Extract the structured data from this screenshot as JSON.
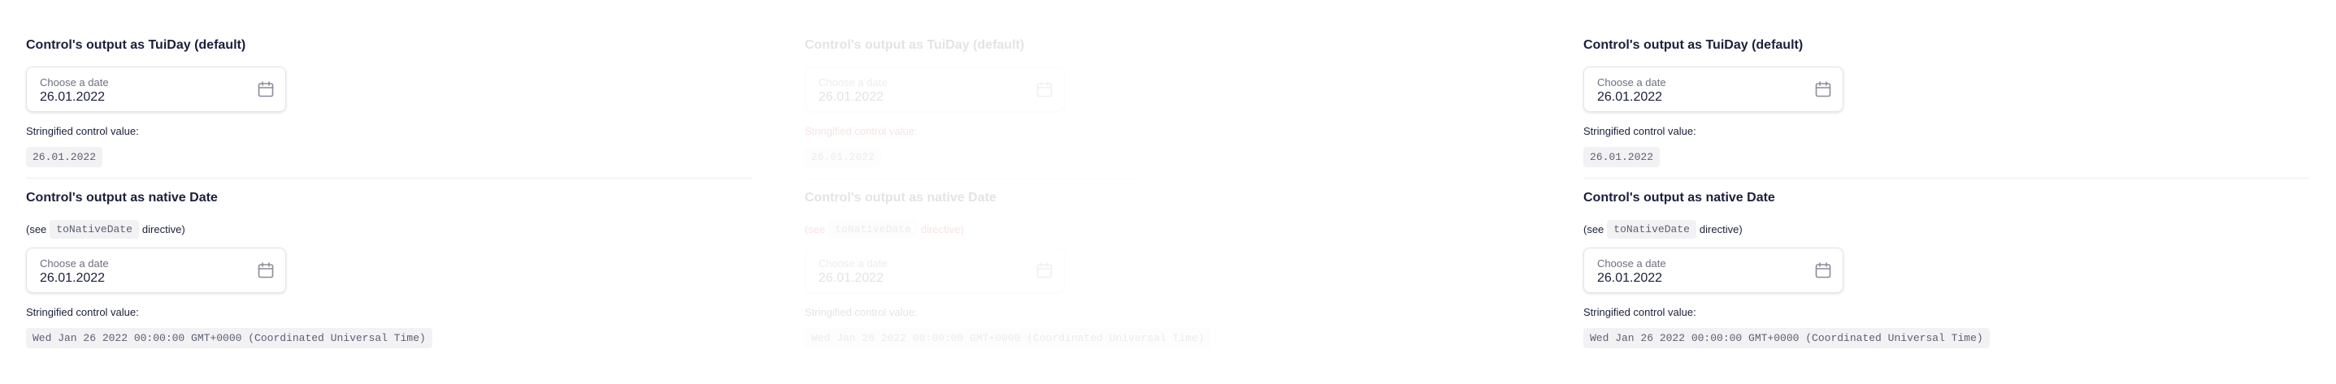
{
  "columns": [
    {
      "section1": {
        "title": "Control's output as TuiDay (default)",
        "date_label": "Choose a date",
        "date_value": "26.01.2022",
        "caption": "Stringified control value:",
        "value": "26.01.2022"
      },
      "section2": {
        "title": "Control's output as native Date",
        "note_prefix": "(see",
        "note_code": "toNativeDate",
        "note_suffix": "directive)",
        "date_label": "Choose a date",
        "date_value": "26.01.2022",
        "caption": "Stringified control value:",
        "value": "Wed Jan 26 2022 00:00:00 GMT+0000 (Coordinated Universal Time)"
      }
    },
    {
      "section1": {
        "title": "Control's output as TuiDay (default)",
        "date_label": "Choose a date",
        "date_value": "26.01.2022",
        "caption": "Stringified control value:",
        "value": "26.01.2022"
      },
      "section2": {
        "title": "Control's output as native Date",
        "note_prefix": "(see",
        "note_code": "toNativeDate",
        "note_suffix": "directive)",
        "date_label": "Choose a date",
        "date_value": "26.01.2022",
        "caption": "Stringified control value:",
        "value": "Wed Jan 26 2022 00:00:00 GMT+0000 (Coordinated Universal Time)"
      }
    },
    {
      "section1": {
        "title": "Control's output as TuiDay (default)",
        "date_label": "Choose a date",
        "date_value": "26.01.2022",
        "caption": "Stringified control value:",
        "value": "26.01.2022"
      },
      "section2": {
        "title": "Control's output as native Date",
        "note_prefix": "(see",
        "note_code": "toNativeDate",
        "note_suffix": "directive)",
        "date_label": "Choose a date",
        "date_value": "26.01.2022",
        "caption": "Stringified control value:",
        "value": "Wed Jan 26 2022 00:00:00 GMT+0000 (Coordinated Universal Time)"
      }
    }
  ],
  "icons": {
    "calendar": "calendar-icon"
  },
  "colors": {
    "text": "#1b1f3b",
    "muted": "#6d6f80",
    "code_bg": "#f2f2f5",
    "border": "#e2e3ea"
  }
}
